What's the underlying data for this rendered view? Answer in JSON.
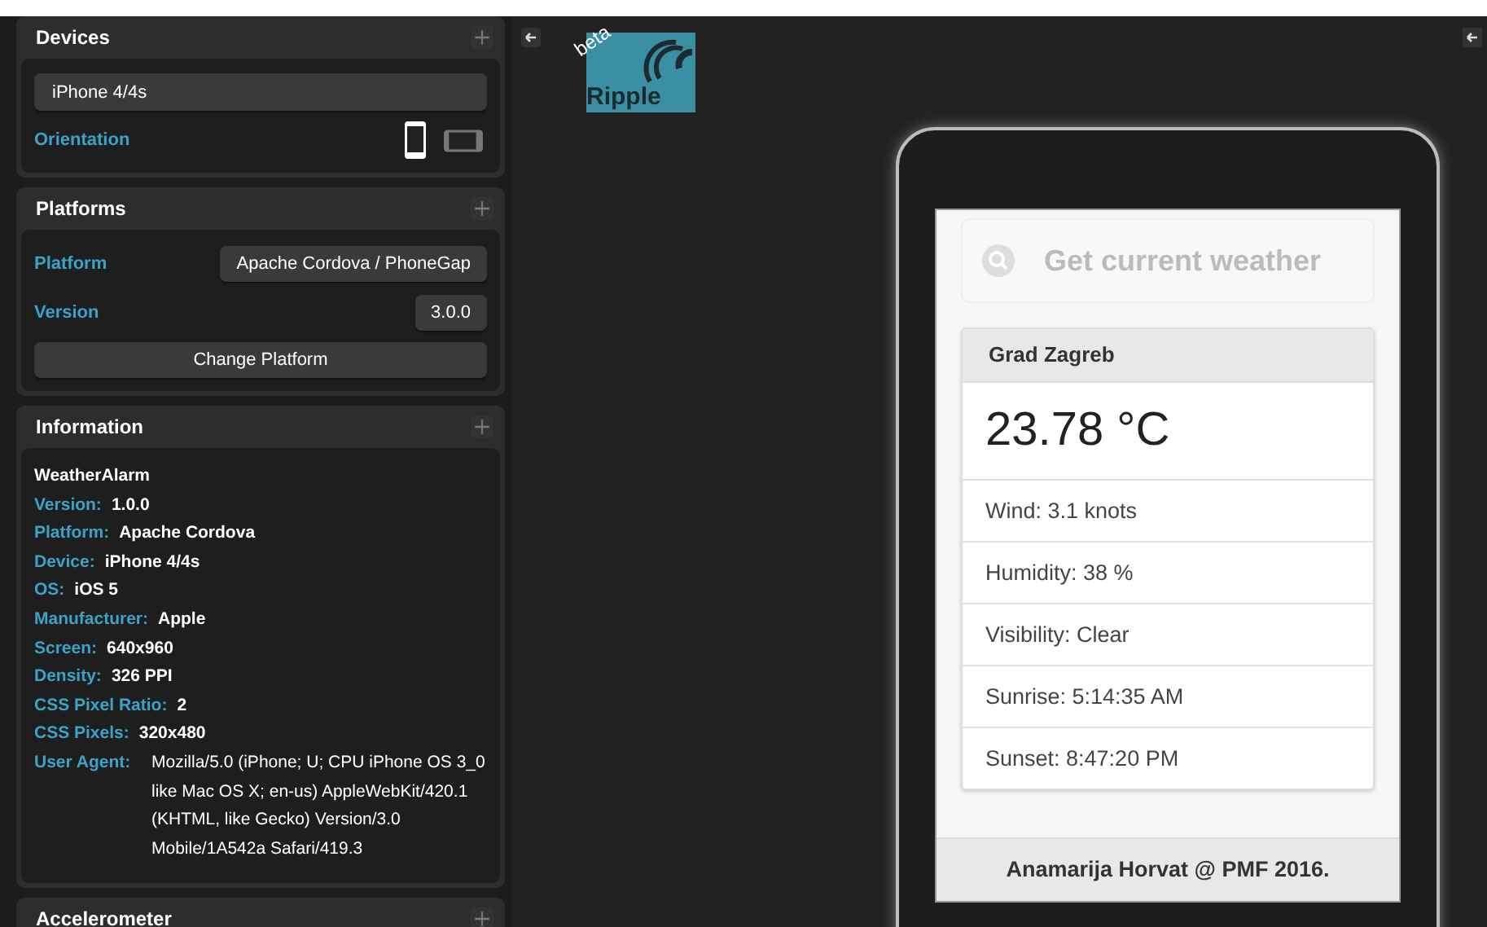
{
  "panels": {
    "devices": {
      "title": "Devices",
      "device": "iPhone 4/4s",
      "orientation_label": "Orientation",
      "orientations": [
        {
          "kind": "portrait",
          "selected": true
        },
        {
          "kind": "landscape",
          "selected": false
        }
      ]
    },
    "platforms": {
      "title": "Platforms",
      "platform_label": "Platform",
      "platform": "Apache Cordova / PhoneGap",
      "version_label": "Version",
      "version": "3.0.0",
      "change_button": "Change Platform"
    },
    "information": {
      "title": "Information",
      "app_name": "WeatherAlarm",
      "rows": [
        {
          "label": "Version:",
          "value": "1.0.0"
        },
        {
          "label": "Platform:",
          "value": "Apache Cordova"
        },
        {
          "label": "Device:",
          "value": "iPhone 4/4s"
        },
        {
          "label": "OS:",
          "value": "iOS 5"
        },
        {
          "label": "Manufacturer:",
          "value": "Apple"
        },
        {
          "label": "Screen:",
          "value": "640x960"
        },
        {
          "label": "Density:",
          "value": "326 PPI"
        },
        {
          "label": "CSS Pixel Ratio:",
          "value": "2"
        },
        {
          "label": "CSS Pixels:",
          "value": "320x480"
        }
      ],
      "user_agent_label": "User Agent:",
      "user_agent": "Mozilla/5.0 (iPhone; U; CPU iPhone OS 3_0 like Mac OS X; en-us) AppleWebKit/420.1 (KHTML, like Gecko) Version/3.0 Mobile/1A542a Safari/419.3"
    },
    "accelerometer": {
      "title": "Accelerometer"
    }
  },
  "logo": {
    "badge": "beta",
    "name": "Ripple"
  },
  "app": {
    "search_button": "Get current weather",
    "city": "Grad Zagreb",
    "temperature": "23.78 °C",
    "details": [
      "Wind: 3.1 knots",
      "Humidity: 38 %",
      "Visibility: Clear",
      "Sunrise: 5:14:35 AM",
      "Sunset: 8:47:20 PM"
    ],
    "footer": "Anamarija Horvat @ PMF 2016."
  }
}
